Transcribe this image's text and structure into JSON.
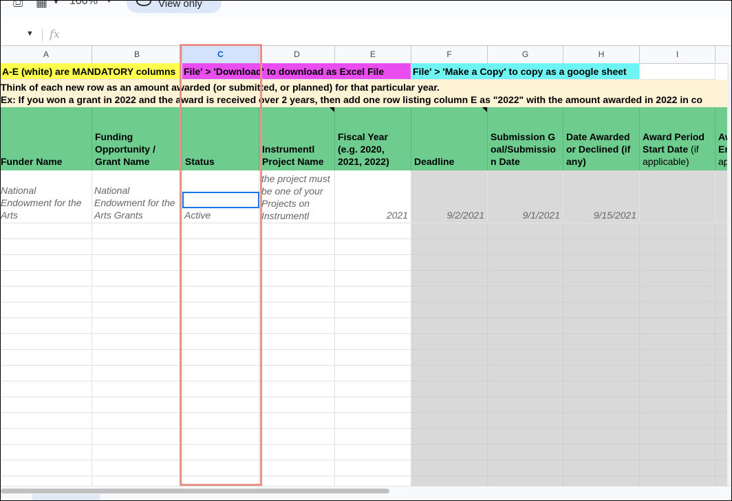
{
  "toolbar": {
    "zoom": "100%",
    "view_only_label": "View only"
  },
  "formula_bar": {
    "fx_label": "fx",
    "value": ""
  },
  "columns": [
    "A",
    "B",
    "C",
    "D",
    "E",
    "F",
    "G",
    "H",
    "I"
  ],
  "selected_column": "C",
  "row1": {
    "a": "A-E (white) are MANDATORY columns",
    "c": "File' > 'Download' to download as Excel File",
    "f": "File' > 'Make a Copy' to copy as a google sheet"
  },
  "info_lines": [
    "Think of each new row as an amount awarded (or submitted, or planned) for that particular year.",
    "Ex: If you won a grant in 2022 and the award is received over 2 years, then add one row listing column E as \"2022\" with the amount awarded in 2022 in co"
  ],
  "headers": {
    "a": "Funder Name",
    "b": "Funding Opportunity / Grant Name",
    "c": "Status",
    "d": "Instrumentl Project Name",
    "e": "Fiscal Year (e.g. 2020, 2021, 2022)",
    "f": "Deadline",
    "g": "Submission Goal/Submission Date",
    "h": "Date Awarded or Declined (if any)",
    "i_bold": "Award Period Start Date",
    "i_note": "(if applicable)",
    "j_bold": "Aw En",
    "j_note": "app"
  },
  "example_row": {
    "a": "National Endowment for the Arts",
    "b": "National Endowment for the Arts Grants",
    "c": "Awarded - Active",
    "d": "the project must be one of your Projects on Instrumentl",
    "e": "2021",
    "f": "9/2/2021",
    "g": "9/1/2021",
    "h": "9/15/2021"
  },
  "colors": {
    "yellow": "#ffff4d",
    "magenta": "#e94df0",
    "cyan": "#6ff4f4",
    "header_green": "#6fcc8f",
    "info_bg": "#fff3d6",
    "highlight": "#e8938a"
  }
}
